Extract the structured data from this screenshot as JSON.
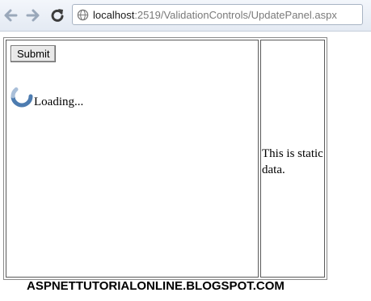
{
  "browser": {
    "back_icon": "back-arrow-icon",
    "forward_icon": "forward-arrow-icon",
    "reload_icon": "reload-icon",
    "address": {
      "icon": "globe-icon",
      "host": "localhost",
      "path": ":2519/ValidationControls/UpdatePanel.aspx"
    }
  },
  "update_panel": {
    "submit_label": "Submit",
    "progress": {
      "icon": "loading-spinner-icon",
      "text": "Loading..."
    }
  },
  "static_panel": {
    "text": "This is static data."
  },
  "footer": {
    "watermark": "ASPNETTUTORIALONLINE.BLOGSPOT.COM"
  },
  "colors": {
    "spinner": "#4d7cb0",
    "toolbar_bg": "#e4eaf3",
    "border": "#5a5a5a"
  }
}
